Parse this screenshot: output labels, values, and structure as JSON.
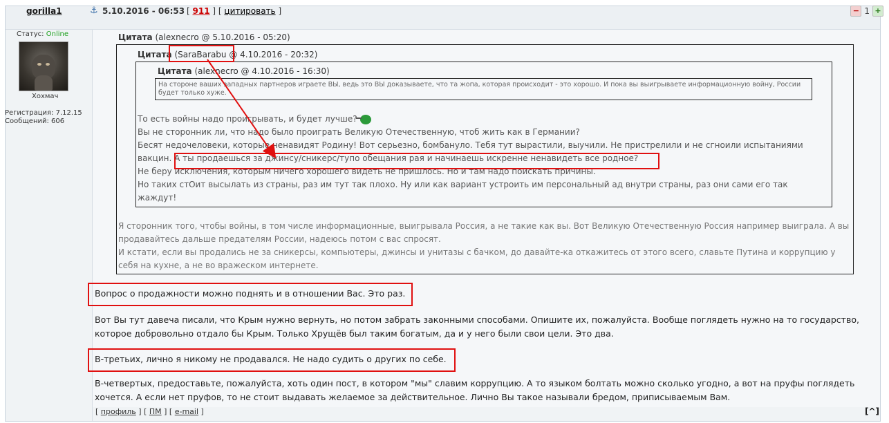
{
  "header": {
    "username": "gorilla1",
    "date": "5.10.2016 - 06:53",
    "open_bracket": "[",
    "post_number": "911",
    "separator": "] [",
    "quote_link": "цитировать",
    "close_bracket": "]",
    "rep_value": "1",
    "rep_minus_icon": "minus-icon",
    "rep_plus_icon": "plus-icon"
  },
  "user": {
    "status_label": "Статус:",
    "status_value": "Online",
    "title": "Хохмач",
    "registration": "Регистрация: 7.12.15",
    "messages": "Сообщений: 606"
  },
  "quote1": {
    "label": "Цитата",
    "meta": "(alexnecro @ 5.10.2016 - 05:20)",
    "body": [
      "Я сторонник того, чтобы войны, в том числе информационные, выигрывала Россия, а не такие как вы. Вот Великую Отечественную Россия например выиграла. А вы продавайтесь дальше предателям России, надеюсь потом с вас спросят.",
      "И кстати, если вы продались не за сникерсы, компьютеры, джинсы и унитазы с бачком, до давайте-ка откажитесь от этого всего, славьте Путина и коррупцию у себя на кухне, а не во вражеском интернете."
    ]
  },
  "quote2": {
    "label": "Цитата",
    "meta_name": "(SaraBarabu @",
    "meta_date": "4.10.2016 - 20:32)",
    "body": [
      "То есть войны надо проигрывать, и будет лучше?",
      "Вы не сторонник ли, что надо было проиграть Великую Отечественную, чтоб жить как в Германии?",
      "Бесят недочеловеки, которые ненавидят Родину! Вот серьезно, бомбануло. Тебя тут вырастили, выучили. Не пристрелили и не сгноили испытаниями вакцин.",
      "А ты продаешься за джинсу/сникерс/тупо обещания рая и начинаешь искренне ненавидеть все родное?",
      "Не беру исключения, которым ничего хорошего видеть не пришлось. Но и там надо поискать причины.",
      "Но таких стОит высылать из страны, раз им тут так плохо. Ну или как вариант устроить им персональный ад внутри страны, раз они сами его так жаждут!"
    ]
  },
  "quote3": {
    "label": "Цитата",
    "meta": "(alexnecro @ 4.10.2016 - 16:30)",
    "body": "На стороне ваших западных партнеров играете ВЫ, ведь это ВЫ доказываете, что та жопа, которая происходит - это хорошо. И пока вы выигрываете информационную войну, России будет только хуже."
  },
  "body": [
    "Вопрос о продажности можно поднять и в отношении Вас. Это раз.",
    "Вот Вы тут давеча писали, что Крым нужно вернуть, но потом забрать законными способами. Опишите их, пожалуйста. Вообще поглядеть нужно на то государство, которое добровольно отдало бы Крым. Только Хрущёв был таким богатым, да и у него были свои цели. Это два.",
    "В-третьих, лично я никому не продавался. Не надо судить о других по себе.",
    "В-четвертых, предоставьте, пожалуйста, хоть один пост, в котором \"мы\" славим коррупцию. А то языком болтать можно сколько угодно, а вот на пруфы поглядеть хочется. А если нет пруфов, то не стоит выдавать желаемое за действительное. Лично Вы такое называли бредом, приписываемым Вам."
  ],
  "footer": {
    "bracket_open": "[",
    "profile": "профиль",
    "sep1": "] [",
    "pm": "ПМ",
    "sep2": "] [",
    "email": "e-mail",
    "bracket_close": "]",
    "top": "[^]"
  },
  "colors": {
    "highlight": "#e01010",
    "online": "#1ea01e",
    "post_number": "#cc0000"
  }
}
